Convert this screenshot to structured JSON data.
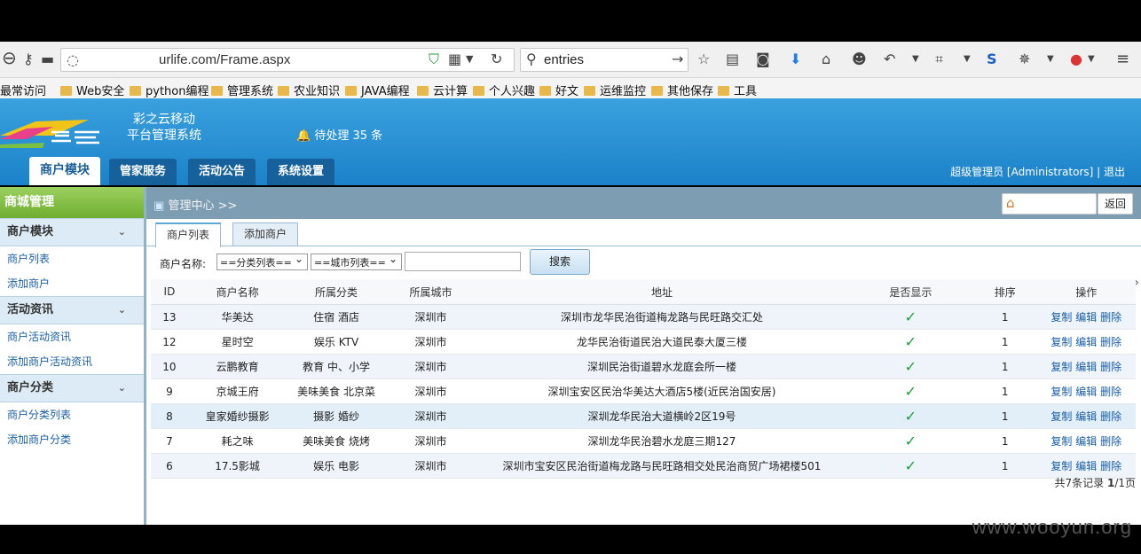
{
  "browser": {
    "url": "urlife.com/Frame.aspx",
    "search": "entries"
  },
  "bookmarks": [
    "最常访问",
    "Web安全",
    "python编程",
    "管理系统",
    "农业知识",
    "JAVA编程",
    "云计算",
    "个人兴趣",
    "好文",
    "运维监控",
    "其他保存",
    "工具"
  ],
  "app": {
    "title1": "彩之云移动",
    "title2": "平台管理系统",
    "pending": "待处理 35 条",
    "tabs": [
      "商户模块",
      "管家服务",
      "活动公告",
      "系统设置"
    ],
    "user": "超级管理员 [Administrators] | 退出"
  },
  "sidebar": {
    "title": "商城管理",
    "groups": [
      {
        "label": "商户模块",
        "items": [
          "商户列表",
          "添加商户"
        ]
      },
      {
        "label": "活动资讯",
        "items": [
          "商户活动资讯",
          "添加商户活动资讯"
        ]
      },
      {
        "label": "商户分类",
        "items": [
          "商户分类列表",
          "添加商户分类"
        ]
      }
    ]
  },
  "content": {
    "breadcrumb": "管理中心 >>",
    "back": "返回",
    "subtabs": [
      "商户列表",
      "添加商户"
    ],
    "filter": {
      "label": "商户名称:",
      "category": "==分类列表==",
      "city": "==城市列表==",
      "search_button": "搜索"
    },
    "columns": [
      "ID",
      "商户名称",
      "所属分类",
      "所属城市",
      "地址",
      "是否显示",
      "排序",
      "操作"
    ],
    "rows": [
      {
        "id": "13",
        "name": "华美达",
        "category": "住宿 酒店",
        "city": "深圳市",
        "address": "深圳市龙华民治街道梅龙路与民旺路交汇处",
        "show": "✓",
        "order": "1"
      },
      {
        "id": "12",
        "name": "星时空",
        "category": "娱乐 KTV",
        "city": "深圳市",
        "address": "龙华民治街道民治大道民泰大厦三楼",
        "show": "✓",
        "order": "1"
      },
      {
        "id": "10",
        "name": "云鹏教育",
        "category": "教育 中、小学",
        "city": "深圳市",
        "address": "深圳民治街道碧水龙庭会所一楼",
        "show": "✓",
        "order": "1"
      },
      {
        "id": "9",
        "name": "京城王府",
        "category": "美味美食 北京菜",
        "city": "深圳市",
        "address": "深圳宝安区民治华美达大酒店5楼(近民治国安居)",
        "show": "✓",
        "order": "1"
      },
      {
        "id": "8",
        "name": "皇家婚纱摄影",
        "category": "摄影 婚纱",
        "city": "深圳市",
        "address": "深圳龙华民治大道横岭2区19号",
        "show": "✓",
        "order": "1"
      },
      {
        "id": "7",
        "name": "耗之味",
        "category": "美味美食 烧烤",
        "city": "深圳市",
        "address": "深圳龙华民治碧水龙庭三期127",
        "show": "✓",
        "order": "1"
      },
      {
        "id": "6",
        "name": "17.5影城",
        "category": "娱乐 电影",
        "city": "深圳市",
        "address": "深圳市宝安区民治街道梅龙路与民旺路相交处民治商贸广场裙楼501",
        "show": "✓",
        "order": "1"
      }
    ],
    "actions": [
      "复制",
      "编辑",
      "删除"
    ],
    "pager": {
      "prefix": "共7条记录 ",
      "page": "1",
      "suffix": "/1页"
    }
  },
  "watermark": "www.wooyun.org"
}
